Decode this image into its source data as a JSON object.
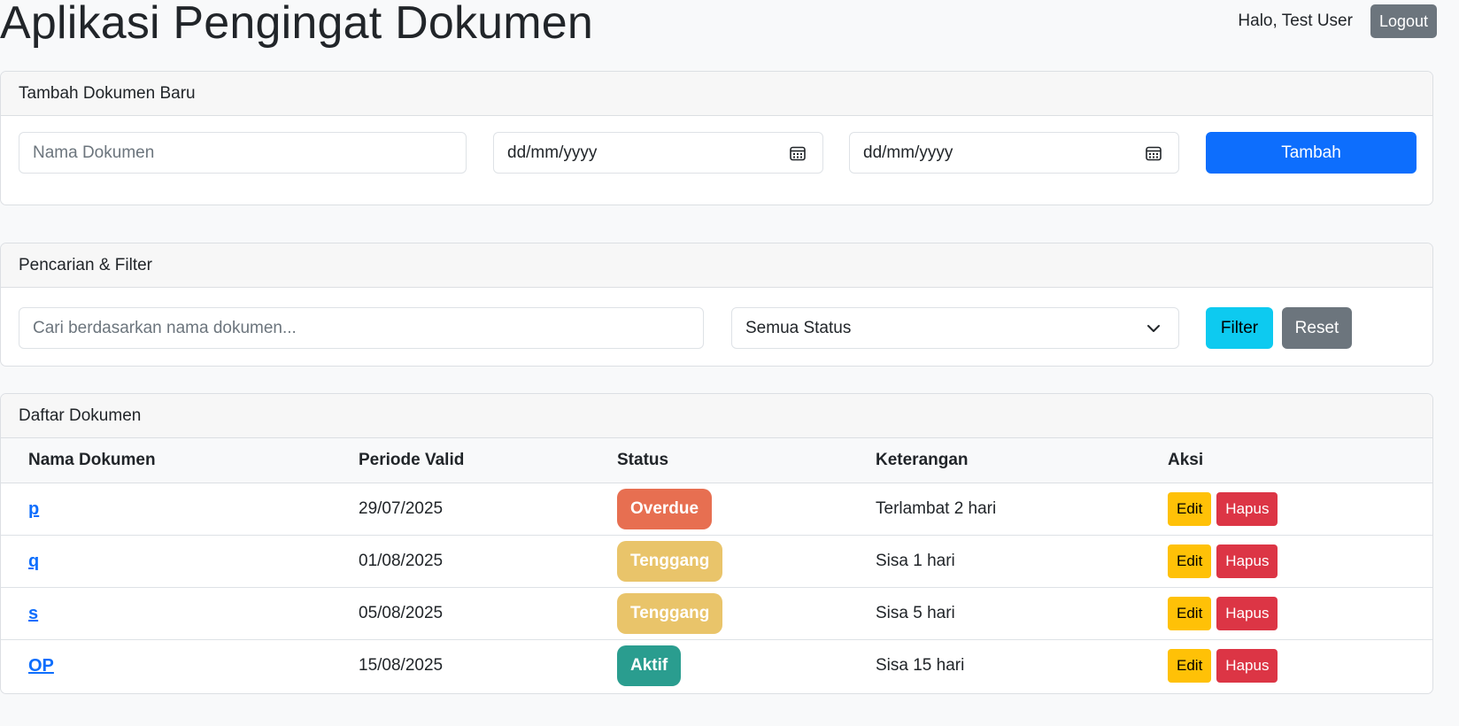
{
  "app": {
    "title": "Aplikasi Pengingat Dokumen",
    "greeting": "Halo, Test User",
    "logout_label": "Logout"
  },
  "add_form": {
    "header": "Tambah Dokumen Baru",
    "name_placeholder": "Nama Dokumen",
    "start_date_placeholder": "dd/mm/yyyy",
    "end_date_placeholder": "dd/mm/yyyy",
    "date_icon": "calendar-icon",
    "submit_label": "Tambah"
  },
  "filter": {
    "header": "Pencarian & Filter",
    "search_placeholder": "Cari berdasarkan nama dokumen...",
    "status_selected": "Semua Status",
    "select_icon": "chevron-down-icon",
    "filter_label": "Filter",
    "reset_label": "Reset"
  },
  "list": {
    "header": "Daftar Dokumen",
    "columns": [
      "Nama Dokumen",
      "Periode Valid",
      "Status",
      "Keterangan",
      "Aksi"
    ],
    "edit_label": "Edit",
    "delete_label": "Hapus",
    "rows": [
      {
        "name": "p",
        "period": "29/07/2025",
        "status": "Overdue",
        "status_color": "#e76f51",
        "note": "Terlambat 2 hari"
      },
      {
        "name": "q",
        "period": "01/08/2025",
        "status": "Tenggang",
        "status_color": "#e9c46a",
        "note": "Sisa 1 hari"
      },
      {
        "name": "s",
        "period": "05/08/2025",
        "status": "Tenggang",
        "status_color": "#e9c46a",
        "note": "Sisa 5 hari"
      },
      {
        "name": "OP",
        "period": "15/08/2025",
        "status": "Aktif",
        "status_color": "#2a9d8f",
        "note": "Sisa 15 hari"
      }
    ]
  },
  "colors": {
    "primary": "#0d6efd",
    "info": "#0dcaf0",
    "secondary": "#6c757d",
    "warning": "#ffc107",
    "danger": "#dc3545"
  }
}
